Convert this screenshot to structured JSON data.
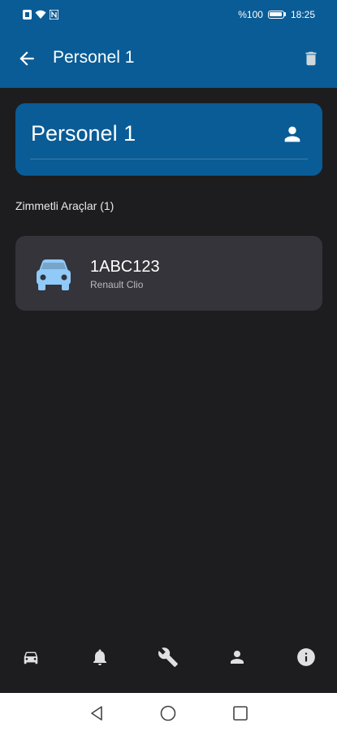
{
  "status_bar": {
    "battery_text": "%100",
    "time": "18:25"
  },
  "app_bar": {
    "title": "Personel 1"
  },
  "person": {
    "name": "Personel 1"
  },
  "vehicles_section": {
    "title": "Zimmetli Araçlar (1)",
    "items": [
      {
        "plate": "1ABC123",
        "model": "Renault Clio"
      }
    ]
  },
  "bottom_nav": {
    "items": [
      "car-icon",
      "bell-icon",
      "wrench-icon",
      "person-icon",
      "info-icon"
    ]
  },
  "colors": {
    "primary": "#0a5c96",
    "background": "#1d1d20",
    "card": "#34343a",
    "car_icon": "#90caf9"
  }
}
